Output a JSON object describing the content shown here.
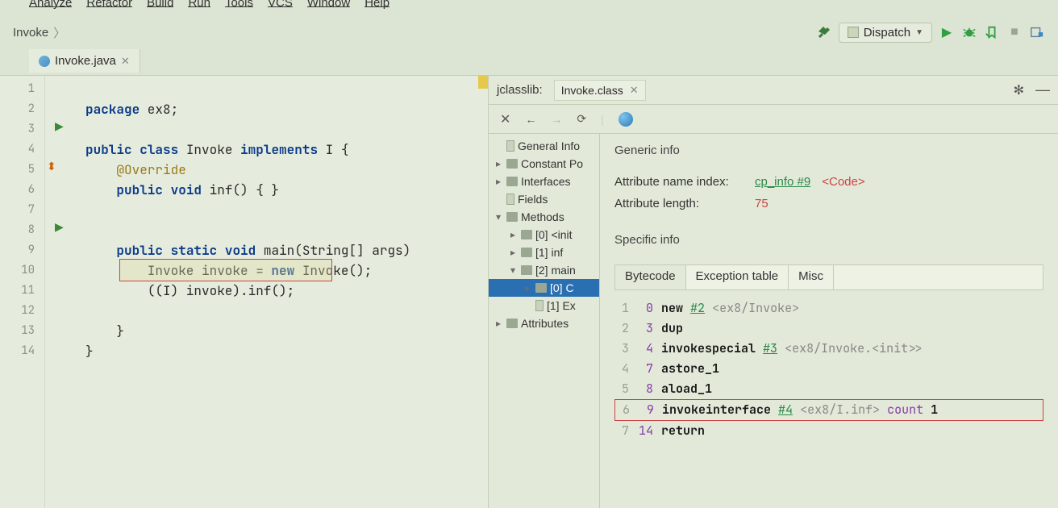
{
  "menu": {
    "items": [
      "Analyze",
      "Refactor",
      "Build",
      "Run",
      "Tools",
      "VCS",
      "Window",
      "Help"
    ]
  },
  "breadcrumb": {
    "item": "Invoke"
  },
  "runconfig": {
    "label": "Dispatch"
  },
  "tabs": {
    "active": "Invoke.java"
  },
  "code": {
    "lines": [
      {
        "n": 1
      },
      {
        "n": 2
      },
      {
        "n": 3,
        "play": true
      },
      {
        "n": 4
      },
      {
        "n": 5,
        "over": true
      },
      {
        "n": 6
      },
      {
        "n": 7
      },
      {
        "n": 8,
        "play": true
      },
      {
        "n": 9
      },
      {
        "n": 10
      },
      {
        "n": 11
      },
      {
        "n": 12
      },
      {
        "n": 13
      },
      {
        "n": 14
      }
    ],
    "src": {
      "l1_kw1": "package",
      "l1_rest": " ex8;",
      "l3_kw1": "public",
      "l3_kw2": "class",
      "l3_name": " Invoke ",
      "l3_kw3": "implements",
      "l3_rest": " I {",
      "l4_ann": "@Override",
      "l5_kw1": "public",
      "l5_kw2": "void",
      "l5_rest": " inf() { }",
      "l8_kw1": "public",
      "l8_kw2": "static",
      "l8_kw3": "void",
      "l8_rest": " main(String[] args)",
      "l9_pre": "        Invoke invoke = ",
      "l9_kw": "new",
      "l9_post": " Invoke();",
      "l10": "        ((I) invoke).inf();",
      "l12": "    }",
      "l13": "}"
    }
  },
  "right": {
    "panelTitle": "jclasslib:",
    "tabLabel": "Invoke.class",
    "tree": [
      {
        "indent": 0,
        "car": "",
        "icon": "file",
        "label": "General Info"
      },
      {
        "indent": 0,
        "car": "right",
        "icon": "fold",
        "label": "Constant Po"
      },
      {
        "indent": 0,
        "car": "right",
        "icon": "fold",
        "label": "Interfaces"
      },
      {
        "indent": 0,
        "car": "",
        "icon": "file",
        "label": "Fields"
      },
      {
        "indent": 0,
        "car": "down",
        "icon": "fold",
        "label": "Methods"
      },
      {
        "indent": 1,
        "car": "right",
        "icon": "fold",
        "label": "[0] <init"
      },
      {
        "indent": 1,
        "car": "right",
        "icon": "fold",
        "label": "[1] inf"
      },
      {
        "indent": 1,
        "car": "down",
        "icon": "fold",
        "label": "[2] main"
      },
      {
        "indent": 2,
        "car": "right",
        "icon": "fold",
        "label": "[0] C",
        "sel": true
      },
      {
        "indent": 2,
        "car": "",
        "icon": "file",
        "label": "[1] Ex"
      },
      {
        "indent": 0,
        "car": "right",
        "icon": "fold",
        "label": "Attributes"
      }
    ],
    "detail": {
      "genericTitle": "Generic info",
      "attrNameLabel": "Attribute name index:",
      "attrNameLink": "cp_info #9",
      "attrNameTag": "<Code>",
      "attrLenLabel": "Attribute length:",
      "attrLenVal": "75",
      "specificTitle": "Specific info",
      "bcTabs": [
        "Bytecode",
        "Exception table",
        "Misc"
      ],
      "bytecode": [
        {
          "ln": "1",
          "off": "0",
          "op": "new",
          "ref": "#2",
          "cmt": "<ex8/Invoke>"
        },
        {
          "ln": "2",
          "off": "3",
          "op": "dup"
        },
        {
          "ln": "3",
          "off": "4",
          "op": "invokespecial",
          "ref": "#3",
          "cmt": "<ex8/Invoke.<init>>"
        },
        {
          "ln": "4",
          "off": "7",
          "op": "astore_1"
        },
        {
          "ln": "5",
          "off": "8",
          "op": "aload_1"
        },
        {
          "ln": "6",
          "off": "9",
          "op": "invokeinterface",
          "ref": "#4",
          "cmt": "<ex8/I.inf>",
          "cnt": "count",
          "cntn": "1",
          "boxed": true
        },
        {
          "ln": "7",
          "off": "14",
          "op": "return"
        }
      ]
    }
  }
}
